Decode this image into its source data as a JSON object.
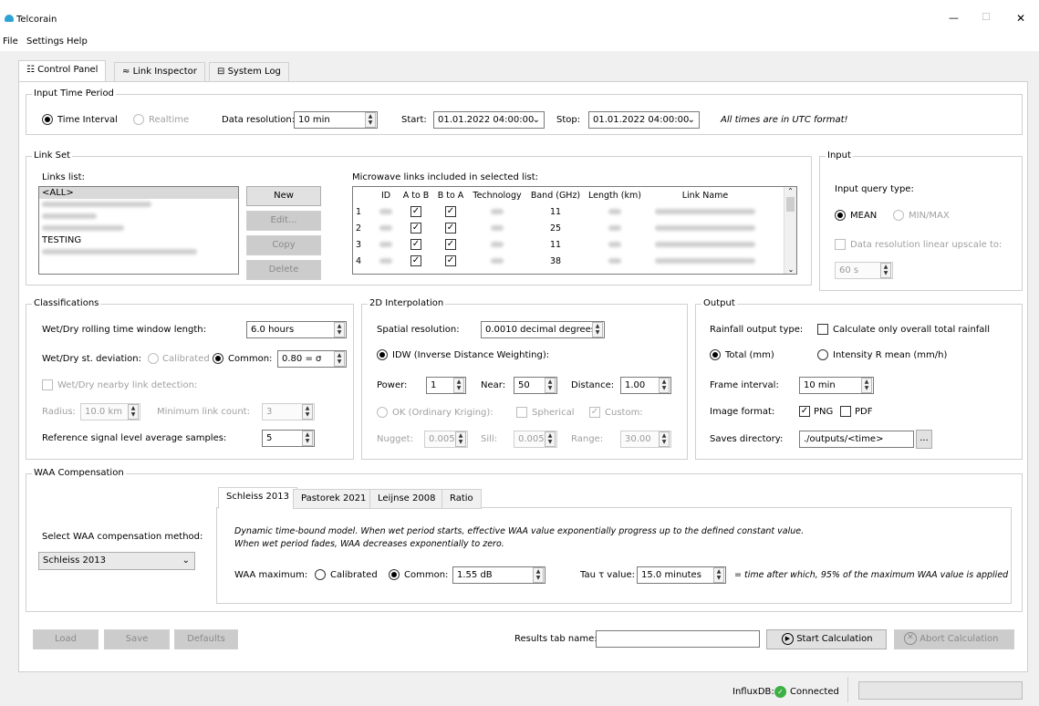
{
  "window": {
    "title": "Telcorain",
    "minimize_icon": "—",
    "maximize_icon": "☐",
    "close_icon": "✕"
  },
  "menu": [
    "File",
    "Settings",
    "Help"
  ],
  "tabs": [
    {
      "label": "Control Panel"
    },
    {
      "label": "Link Inspector"
    },
    {
      "label": "System Log"
    }
  ],
  "time_period": {
    "title": "Input Time Period",
    "time_interval_label": "Time Interval",
    "realtime_label": "Realtime",
    "resolution_label": "Data resolution:",
    "resolution_value": "10 min",
    "start_label": "Start:",
    "start_value": "01.01.2022 04:00:00",
    "stop_label": "Stop:",
    "stop_value": "01.01.2022 04:00:00",
    "utc_note": "All times are in UTC format!"
  },
  "link_set": {
    "title": "Link Set",
    "links_label": "Links list:",
    "links": [
      "<ALL>",
      "",
      "",
      "",
      "TESTING",
      ""
    ],
    "buttons": {
      "new": "New",
      "edit": "Edit...",
      "copy": "Copy",
      "delete": "Delete"
    },
    "table_label": "Microwave links included in selected list:",
    "columns": [
      "ID",
      "A to B",
      "B to A",
      "Technology",
      "Band (GHz)",
      "Length (km)",
      "Link Name"
    ],
    "rows": [
      {
        "num": "1",
        "band": "11"
      },
      {
        "num": "2",
        "band": "25"
      },
      {
        "num": "3",
        "band": "11"
      },
      {
        "num": "4",
        "band": "38"
      }
    ]
  },
  "input": {
    "title": "Input",
    "query_label": "Input query type:",
    "mean_label": "MEAN",
    "minmax_label": "MIN/MAX",
    "upscale_label": "Data resolution linear upscale to:",
    "upscale_value": "60 s"
  },
  "classifications": {
    "title": "Classifications",
    "window_label": "Wet/Dry rolling time window length:",
    "window_value": "6.0 hours",
    "stdev_label": "Wet/Dry st. deviation:",
    "calibrated_label": "Calibrated",
    "common_label": "Common:",
    "common_value": "0.80 = σ",
    "nearby_label": "Wet/Dry nearby link detection:",
    "radius_label": "Radius:",
    "radius_value": "10.0 km",
    "min_count_label": "Minimum link count:",
    "min_count_value": "3",
    "ref_label": "Reference signal level average samples:",
    "ref_value": "5"
  },
  "interp": {
    "title": "2D Interpolation",
    "spatial_label": "Spatial resolution:",
    "spatial_value": "0.0010 decimal degrees",
    "idw_label": "IDW (Inverse Distance Weighting):",
    "power_label": "Power:",
    "power_value": "1",
    "near_label": "Near:",
    "near_value": "50",
    "distance_label": "Distance:",
    "distance_value": "1.00",
    "ok_label": "OK (Ordinary Kriging):",
    "spherical_label": "Spherical",
    "custom_label": "Custom:",
    "nugget_label": "Nugget:",
    "nugget_value": "0.005",
    "sill_label": "Sill:",
    "sill_value": "0.005",
    "range_label": "Range:",
    "range_value": "30.00"
  },
  "output": {
    "title": "Output",
    "type_label": "Rainfall output type:",
    "overall_label": "Calculate only overall total rainfall",
    "total_label": "Total (mm)",
    "intensity_label": "Intensity R mean (mm/h)",
    "frame_label": "Frame interval:",
    "frame_value": "10 min",
    "format_label": "Image format:",
    "png_label": "PNG",
    "pdf_label": "PDF",
    "saves_label": "Saves directory:",
    "saves_value": "./outputs/<time>",
    "browse_label": "..."
  },
  "waa": {
    "title": "WAA Compensation",
    "method_label": "Select WAA compensation method:",
    "method_value": "Schleiss 2013",
    "tabs": [
      "Schleiss 2013",
      "Pastorek 2021",
      "Leijnse 2008",
      "Ratio"
    ],
    "desc1": "Dynamic time-bound model. When wet period starts, effective WAA value exponentially progress up to the defined constant value.",
    "desc2": "When wet period fades, WAA decreases exponentially to zero.",
    "max_label": "WAA maximum:",
    "calibrated_label": "Calibrated",
    "common_label": "Common:",
    "common_value": "1.55 dB",
    "tau_label": "Tau τ value:",
    "tau_value": "15.0 minutes",
    "tau_note": "= time after which, 95% of the maximum WAA value is applied"
  },
  "bottom": {
    "load": "Load",
    "save": "Save",
    "defaults": "Defaults",
    "results_label": "Results tab name:",
    "results_value": "",
    "start": "Start Calculation",
    "abort": "Abort Calculation"
  },
  "status": {
    "influx_label": "InfluxDB:",
    "influx_state": "Connected",
    "colors": {
      "connected": "#3cb043",
      "accent": "#0078d7"
    }
  }
}
